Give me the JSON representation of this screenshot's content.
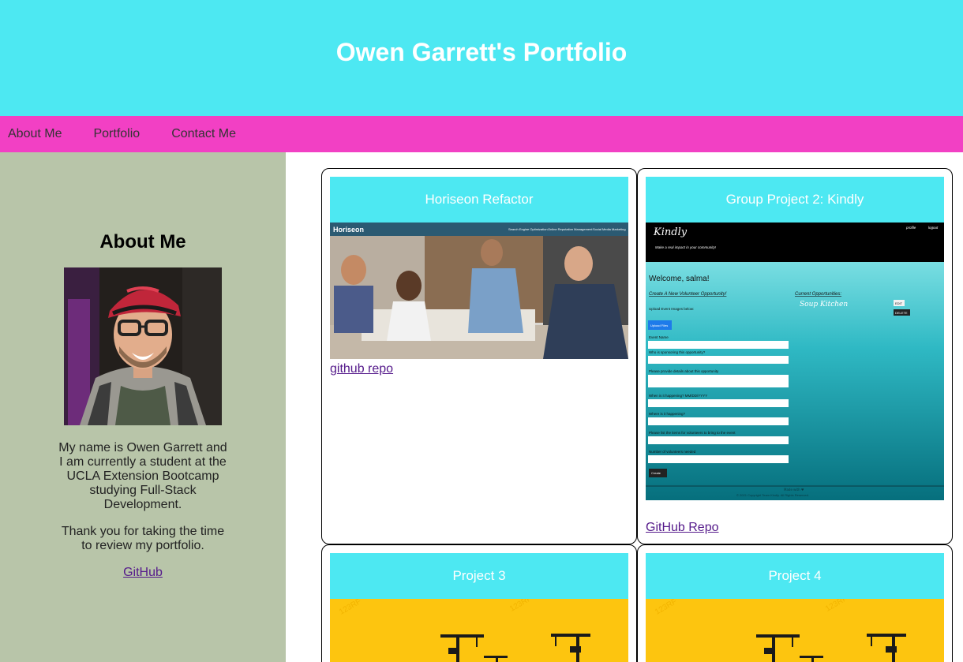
{
  "header": {
    "title": "Owen Garrett's Portfolio"
  },
  "nav": {
    "items": [
      "About Me",
      "Portfolio",
      "Contact Me"
    ]
  },
  "sidebar": {
    "heading": "About Me",
    "bio": "My name is Owen Garrett and I am currently a student at the UCLA Extension Bootcamp studying Full-Stack Development.",
    "thanks": "Thank you for taking the time to review my portfolio.",
    "github_link": "GitHub"
  },
  "projects": [
    {
      "title": "Horiseon Refactor",
      "link": "github repo",
      "screenshot": {
        "logo": "Horiseon",
        "nav": [
          "Search Engine Optimization",
          "Online Reputation Management",
          "Social Media Marketing"
        ]
      }
    },
    {
      "title": "Group Project 2: Kindly",
      "link": "GitHub Repo",
      "screenshot": {
        "logo": "Kindly",
        "tagline": "Make a real impact in your community!",
        "nav": [
          "profile",
          "logout"
        ],
        "welcome": "Welcome, salma!",
        "create_heading": "Create A New Volunteer Opportunity!",
        "current_heading": "Current Opportunities:",
        "opportunity": "Soup Kitchen",
        "edit_label": "EDIT",
        "delete_label": "DELETE",
        "upload_label": "Upload Event Images below:",
        "upload_button": "Upload Files",
        "fields": [
          "Event Name",
          "Who is sponsoring this opportunity?",
          "Please provide details about this opportunity",
          "When is it happening? MM/DD/YYYY",
          "Where is it happening?",
          "Please list the items for volunteers to bring to the event",
          "Number of volunteers needed"
        ],
        "create_button": "Create",
        "footer_made": "Made with ♥",
        "footer_copy": "© 2021 Copyright Team Kindly. All Rights Reserved."
      }
    },
    {
      "title": "Project 3",
      "watermark": "123RF"
    },
    {
      "title": "Project 4",
      "watermark": "123RF"
    }
  ],
  "colors": {
    "header_bg": "#4de8f2",
    "nav_bg": "#f240c4",
    "sidebar_bg": "#b8c5a9",
    "card_title_bg": "#4de8f2",
    "construction_bg": "#fdc50f"
  }
}
